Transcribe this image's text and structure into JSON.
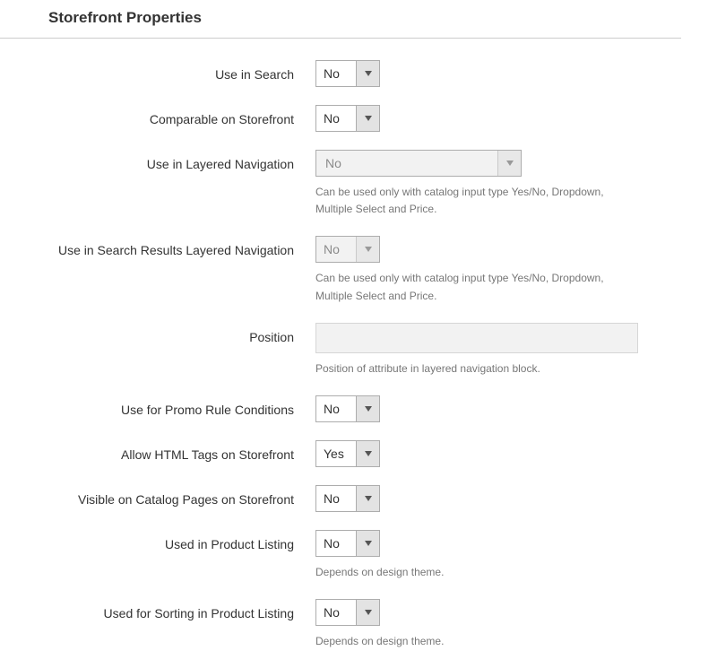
{
  "section_title": "Storefront Properties",
  "fields": {
    "use_in_search": {
      "label": "Use in Search",
      "value": "No"
    },
    "comparable": {
      "label": "Comparable on Storefront",
      "value": "No"
    },
    "layered_nav": {
      "label": "Use in Layered Navigation",
      "value": "No",
      "help": "Can be used only with catalog input type Yes/No, Dropdown, Multiple Select and Price."
    },
    "search_results_layered": {
      "label": "Use in Search Results Layered Navigation",
      "value": "No",
      "help": "Can be used only with catalog input type Yes/No, Dropdown, Multiple Select and Price."
    },
    "position": {
      "label": "Position",
      "value": "",
      "help": "Position of attribute in layered navigation block."
    },
    "promo_rule": {
      "label": "Use for Promo Rule Conditions",
      "value": "No"
    },
    "allow_html": {
      "label": "Allow HTML Tags on Storefront",
      "value": "Yes"
    },
    "visible_catalog": {
      "label": "Visible on Catalog Pages on Storefront",
      "value": "No"
    },
    "product_listing": {
      "label": "Used in Product Listing",
      "value": "No",
      "help": "Depends on design theme."
    },
    "sorting_listing": {
      "label": "Used for Sorting in Product Listing",
      "value": "No",
      "help": "Depends on design theme."
    }
  }
}
